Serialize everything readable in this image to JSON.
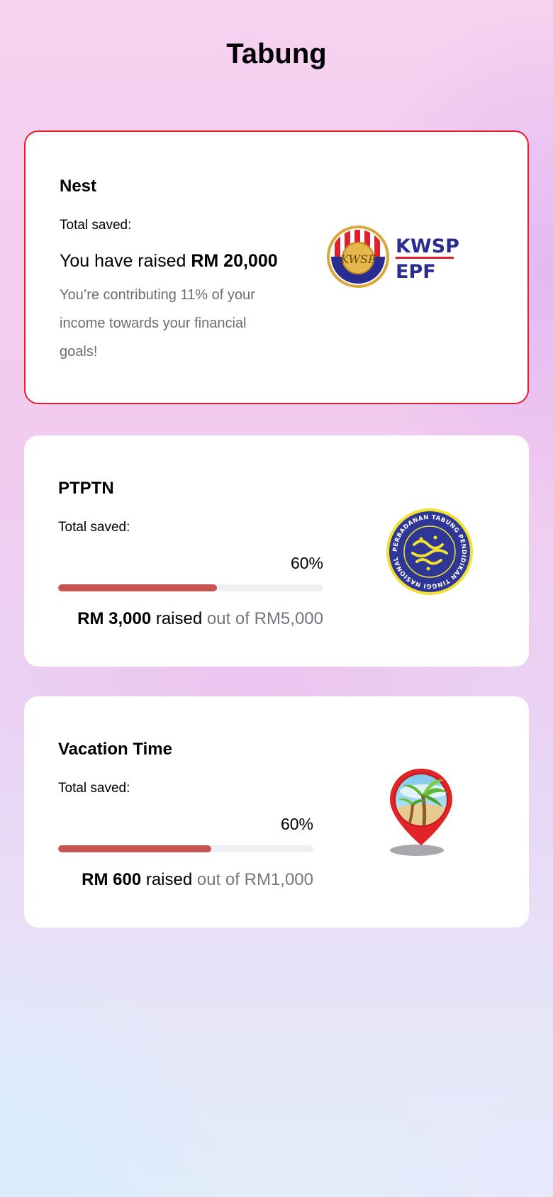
{
  "page": {
    "title": "Tabung"
  },
  "accent_color": "#e41e2b",
  "progress_color": "#c85451",
  "cards": [
    {
      "name": "Nest",
      "total_label": "Total saved:",
      "raised_prefix": "You have raised",
      "raised_amount": "RM 20,000",
      "note": "You’re contributing 11% of your income towards your financial goals!",
      "logo": {
        "icon": "kwsp-epf-logo",
        "line1": "KWSP",
        "line2": "EPF",
        "seal": "KWSP"
      }
    },
    {
      "name": "PTPTN",
      "total_label": "Total saved:",
      "percent_label": "60%",
      "progress": 0.6,
      "raised_amount": "RM 3,000",
      "raised_word": "raised",
      "out_of": "out of RM5,000",
      "logo": {
        "icon": "ptptn-seal-logo",
        "ring_text": "PERBADANAN TABUNG PENDIDIKAN TINGGI NASIONAL PTPTN"
      }
    },
    {
      "name": "Vacation Time",
      "total_label": "Total saved:",
      "percent_label": "60%",
      "progress": 0.6,
      "raised_amount": "RM 600",
      "raised_word": "raised",
      "out_of": "out of RM1,000",
      "logo": {
        "icon": "palm-tree-location-pin-icon"
      }
    }
  ]
}
